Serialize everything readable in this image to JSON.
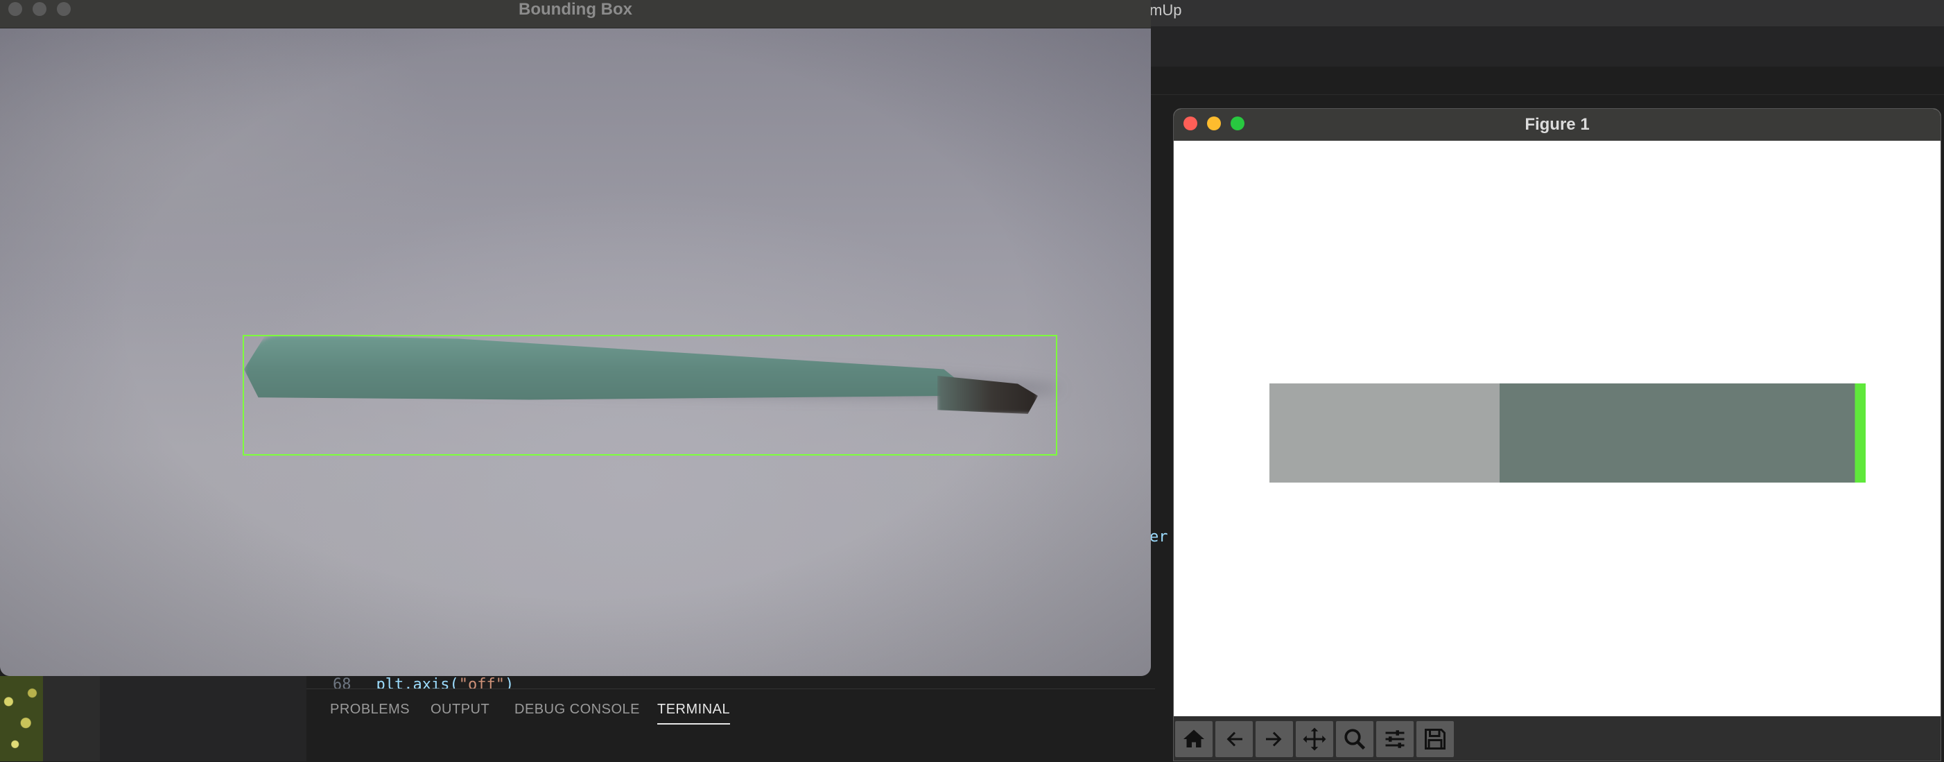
{
  "editor": {
    "title_fragment": "mUp",
    "code_line_number": "68",
    "code_prefix": "plt.axis(",
    "code_string": "\"off\"",
    "code_suffix": ")",
    "side_fragment": "er",
    "panel_tabs": [
      {
        "label": "PROBLEMS"
      },
      {
        "label": "OUTPUT"
      },
      {
        "label": "DEBUG CONSOLE"
      },
      {
        "label": "TERMINAL",
        "active": true
      }
    ]
  },
  "bbox_window": {
    "title": "Bounding Box",
    "box_color": "#7dff3c"
  },
  "figure_window": {
    "title": "Figure 1",
    "toolbar": [
      {
        "name": "home-icon"
      },
      {
        "name": "back-arrow-icon"
      },
      {
        "name": "forward-arrow-icon"
      },
      {
        "name": "pan-move-icon"
      },
      {
        "name": "zoom-magnifier-icon"
      },
      {
        "name": "configure-subplots-icon"
      },
      {
        "name": "save-icon"
      }
    ]
  },
  "chart_data": {
    "type": "bar",
    "orientation": "horizontal-stacked",
    "axis": "off",
    "segments": [
      {
        "color": "#a3a6a5",
        "fraction": 0.386
      },
      {
        "color": "#6a7b75",
        "fraction": 0.596
      },
      {
        "color": "#5fe83b",
        "fraction": 0.018
      }
    ]
  }
}
